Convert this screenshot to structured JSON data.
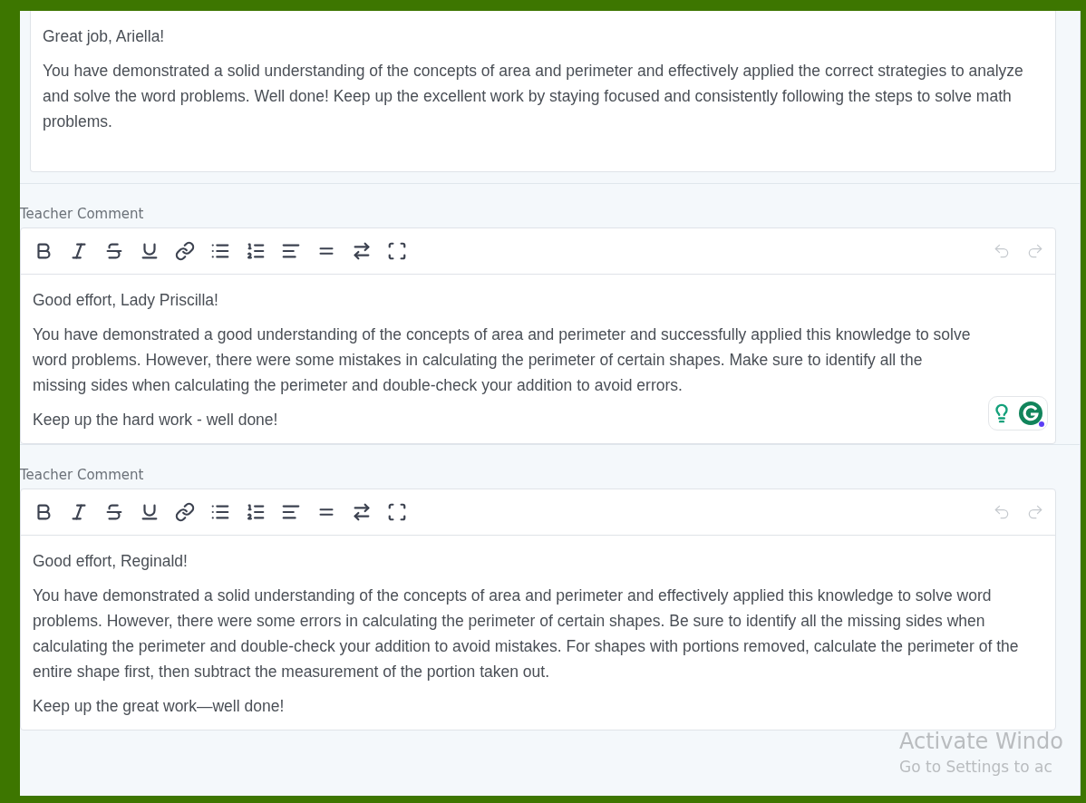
{
  "comments": [
    {
      "kind": "plain",
      "paragraphs": [
        "Great job, Ariella!",
        "You have demonstrated a solid understanding of the concepts of area and perimeter and effectively applied the correct strategies to analyze and solve the word problems. Well done! Keep up the excellent work by staying focused and consistently following the steps to solve math problems."
      ]
    },
    {
      "kind": "editor",
      "label": "Teacher Comment",
      "undo_disabled": true,
      "redo_disabled": true,
      "assistant_badge": true,
      "paragraphs": [
        "Good effort, Lady Priscilla!",
        "You have demonstrated a good understanding of the concepts of area and perimeter and successfully applied this knowledge to solve word problems. However, there were some mistakes in calculating the perimeter of certain shapes. Make sure to identify all the missing sides when calculating the perimeter and double-check your addition to avoid errors.",
        "Keep up the hard work - well done!"
      ]
    },
    {
      "kind": "editor",
      "label": "Teacher Comment",
      "undo_disabled": true,
      "redo_disabled": true,
      "paragraphs": [
        "Good effort, Reginald!",
        "You have demonstrated a solid understanding of the concepts of area and perimeter and effectively applied this knowledge to solve word problems. However, there were some errors in calculating the perimeter of certain shapes. Be sure to identify all the missing sides when calculating the perimeter and double-check your addition to avoid mistakes. For shapes with portions removed, calculate the perimeter of the entire shape first, then subtract the measurement of the portion taken out.",
        "Keep up the great work—well done!"
      ]
    }
  ],
  "os_notice": {
    "title": "Activate Windo",
    "subtitle": "Go to Settings to ac"
  }
}
